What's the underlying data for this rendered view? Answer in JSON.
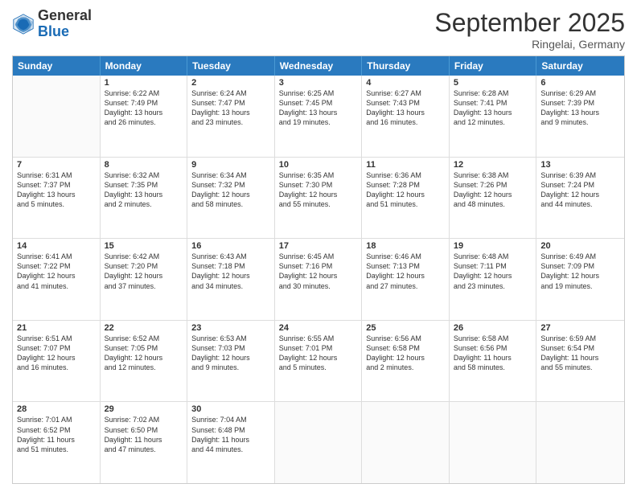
{
  "header": {
    "logo_general": "General",
    "logo_blue": "Blue",
    "month_title": "September 2025",
    "subtitle": "Ringelai, Germany"
  },
  "weekdays": [
    "Sunday",
    "Monday",
    "Tuesday",
    "Wednesday",
    "Thursday",
    "Friday",
    "Saturday"
  ],
  "rows": [
    [
      {
        "day": "",
        "text": ""
      },
      {
        "day": "1",
        "text": "Sunrise: 6:22 AM\nSunset: 7:49 PM\nDaylight: 13 hours\nand 26 minutes."
      },
      {
        "day": "2",
        "text": "Sunrise: 6:24 AM\nSunset: 7:47 PM\nDaylight: 13 hours\nand 23 minutes."
      },
      {
        "day": "3",
        "text": "Sunrise: 6:25 AM\nSunset: 7:45 PM\nDaylight: 13 hours\nand 19 minutes."
      },
      {
        "day": "4",
        "text": "Sunrise: 6:27 AM\nSunset: 7:43 PM\nDaylight: 13 hours\nand 16 minutes."
      },
      {
        "day": "5",
        "text": "Sunrise: 6:28 AM\nSunset: 7:41 PM\nDaylight: 13 hours\nand 12 minutes."
      },
      {
        "day": "6",
        "text": "Sunrise: 6:29 AM\nSunset: 7:39 PM\nDaylight: 13 hours\nand 9 minutes."
      }
    ],
    [
      {
        "day": "7",
        "text": "Sunrise: 6:31 AM\nSunset: 7:37 PM\nDaylight: 13 hours\nand 5 minutes."
      },
      {
        "day": "8",
        "text": "Sunrise: 6:32 AM\nSunset: 7:35 PM\nDaylight: 13 hours\nand 2 minutes."
      },
      {
        "day": "9",
        "text": "Sunrise: 6:34 AM\nSunset: 7:32 PM\nDaylight: 12 hours\nand 58 minutes."
      },
      {
        "day": "10",
        "text": "Sunrise: 6:35 AM\nSunset: 7:30 PM\nDaylight: 12 hours\nand 55 minutes."
      },
      {
        "day": "11",
        "text": "Sunrise: 6:36 AM\nSunset: 7:28 PM\nDaylight: 12 hours\nand 51 minutes."
      },
      {
        "day": "12",
        "text": "Sunrise: 6:38 AM\nSunset: 7:26 PM\nDaylight: 12 hours\nand 48 minutes."
      },
      {
        "day": "13",
        "text": "Sunrise: 6:39 AM\nSunset: 7:24 PM\nDaylight: 12 hours\nand 44 minutes."
      }
    ],
    [
      {
        "day": "14",
        "text": "Sunrise: 6:41 AM\nSunset: 7:22 PM\nDaylight: 12 hours\nand 41 minutes."
      },
      {
        "day": "15",
        "text": "Sunrise: 6:42 AM\nSunset: 7:20 PM\nDaylight: 12 hours\nand 37 minutes."
      },
      {
        "day": "16",
        "text": "Sunrise: 6:43 AM\nSunset: 7:18 PM\nDaylight: 12 hours\nand 34 minutes."
      },
      {
        "day": "17",
        "text": "Sunrise: 6:45 AM\nSunset: 7:16 PM\nDaylight: 12 hours\nand 30 minutes."
      },
      {
        "day": "18",
        "text": "Sunrise: 6:46 AM\nSunset: 7:13 PM\nDaylight: 12 hours\nand 27 minutes."
      },
      {
        "day": "19",
        "text": "Sunrise: 6:48 AM\nSunset: 7:11 PM\nDaylight: 12 hours\nand 23 minutes."
      },
      {
        "day": "20",
        "text": "Sunrise: 6:49 AM\nSunset: 7:09 PM\nDaylight: 12 hours\nand 19 minutes."
      }
    ],
    [
      {
        "day": "21",
        "text": "Sunrise: 6:51 AM\nSunset: 7:07 PM\nDaylight: 12 hours\nand 16 minutes."
      },
      {
        "day": "22",
        "text": "Sunrise: 6:52 AM\nSunset: 7:05 PM\nDaylight: 12 hours\nand 12 minutes."
      },
      {
        "day": "23",
        "text": "Sunrise: 6:53 AM\nSunset: 7:03 PM\nDaylight: 12 hours\nand 9 minutes."
      },
      {
        "day": "24",
        "text": "Sunrise: 6:55 AM\nSunset: 7:01 PM\nDaylight: 12 hours\nand 5 minutes."
      },
      {
        "day": "25",
        "text": "Sunrise: 6:56 AM\nSunset: 6:58 PM\nDaylight: 12 hours\nand 2 minutes."
      },
      {
        "day": "26",
        "text": "Sunrise: 6:58 AM\nSunset: 6:56 PM\nDaylight: 11 hours\nand 58 minutes."
      },
      {
        "day": "27",
        "text": "Sunrise: 6:59 AM\nSunset: 6:54 PM\nDaylight: 11 hours\nand 55 minutes."
      }
    ],
    [
      {
        "day": "28",
        "text": "Sunrise: 7:01 AM\nSunset: 6:52 PM\nDaylight: 11 hours\nand 51 minutes."
      },
      {
        "day": "29",
        "text": "Sunrise: 7:02 AM\nSunset: 6:50 PM\nDaylight: 11 hours\nand 47 minutes."
      },
      {
        "day": "30",
        "text": "Sunrise: 7:04 AM\nSunset: 6:48 PM\nDaylight: 11 hours\nand 44 minutes."
      },
      {
        "day": "",
        "text": ""
      },
      {
        "day": "",
        "text": ""
      },
      {
        "day": "",
        "text": ""
      },
      {
        "day": "",
        "text": ""
      }
    ]
  ]
}
